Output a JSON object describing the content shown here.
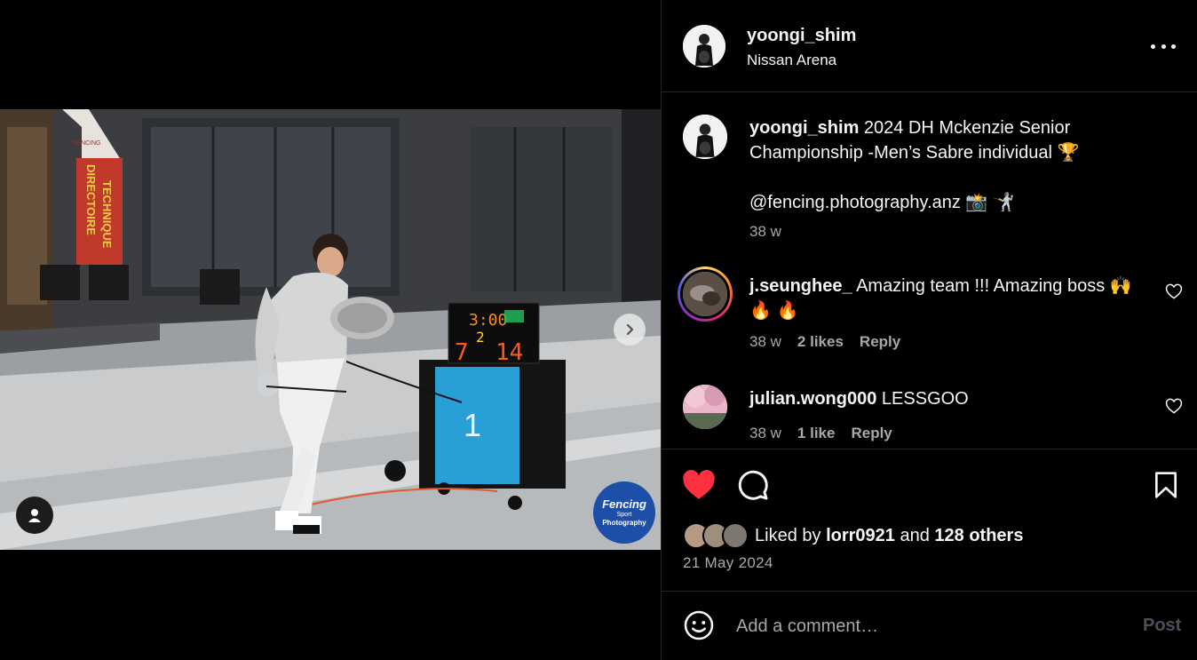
{
  "post": {
    "username": "yoongi_shim",
    "location": "Nissan Arena",
    "caption_line1": "2024 DH Mckenzie Senior",
    "caption_line2": "Championship -Men’s Sabre individual 🏆",
    "caption_mention": "@fencing.photography.anz 📸 🤺",
    "caption_age": "38 w"
  },
  "photo": {
    "banner_text_1": "DIRECTOIRE",
    "banner_text_2": "TECHNIQUE",
    "banner_logo": "FENCING",
    "scoreboard_time": "3:00",
    "scoreboard_left": "7",
    "scoreboard_mid": "2",
    "scoreboard_right": "14",
    "piste_number": "1",
    "watermark_line1": "Fencing",
    "watermark_line2": "Sport",
    "watermark_line3": "Photography",
    "icon_next": "chevron-right-icon",
    "icon_tag": "user-tag-icon"
  },
  "comments": [
    {
      "username": "j.seunghee_",
      "text_line1": "Amazing team !!! Amazing boss 🙌",
      "text_line2": "🔥 🔥",
      "age": "38 w",
      "likes": "2 likes",
      "reply": "Reply"
    },
    {
      "username": "julian.wong000",
      "text_line1": "LESSGOO",
      "age": "38 w",
      "likes": "1 like",
      "reply": "Reply"
    }
  ],
  "actions": {
    "icon_like": "heart-filled-icon",
    "icon_comment": "comment-bubble-icon",
    "icon_save": "bookmark-icon",
    "liked_prefix": "Liked by",
    "liked_user": "lorr0921",
    "liked_and": "and",
    "liked_others": "128 others",
    "date": "21 May 2024"
  },
  "composer": {
    "placeholder": "Add a comment…",
    "post_label": "Post",
    "icon_emoji": "emoji-smiley-icon"
  },
  "colors": {
    "like_red": "#ff3040",
    "muted_text": "#a8a8a8",
    "divider": "#262626",
    "post_disabled": "#4b4f59"
  }
}
